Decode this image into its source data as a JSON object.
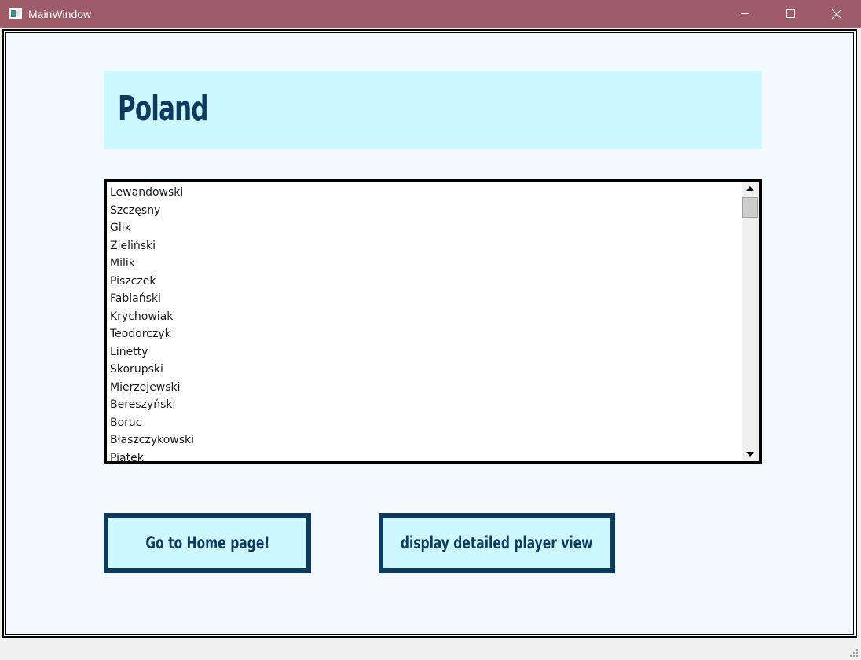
{
  "window": {
    "title": "MainWindow"
  },
  "header": {
    "title": "Poland"
  },
  "players": {
    "items": [
      "Lewandowski",
      "Szczęsny",
      "Glik",
      "Zieliński",
      "Milik",
      "Piszczek",
      "Fabiański",
      "Krychowiak",
      "Teodorczyk",
      "Linetty",
      "Skorupski",
      "Mierzejewski",
      "Bereszyński",
      "Boruc",
      "Błaszczykowski",
      "Piątek"
    ]
  },
  "buttons": {
    "home_label": "Go to Home page!",
    "detail_label": "display detailed player view"
  },
  "icons": {
    "app": "window-app-icon",
    "minimize": "minimize-icon",
    "maximize": "maximize-icon",
    "close": "close-icon",
    "scroll_up": "scroll-up-arrow-icon",
    "scroll_down": "scroll-down-arrow-icon",
    "resize": "resize-grip-icon"
  },
  "colors": {
    "titlebar": "#9e5b68",
    "accent_dark": "#0f3a5f",
    "accent_light": "#cdf8ff",
    "background": "#f3f9ff"
  }
}
